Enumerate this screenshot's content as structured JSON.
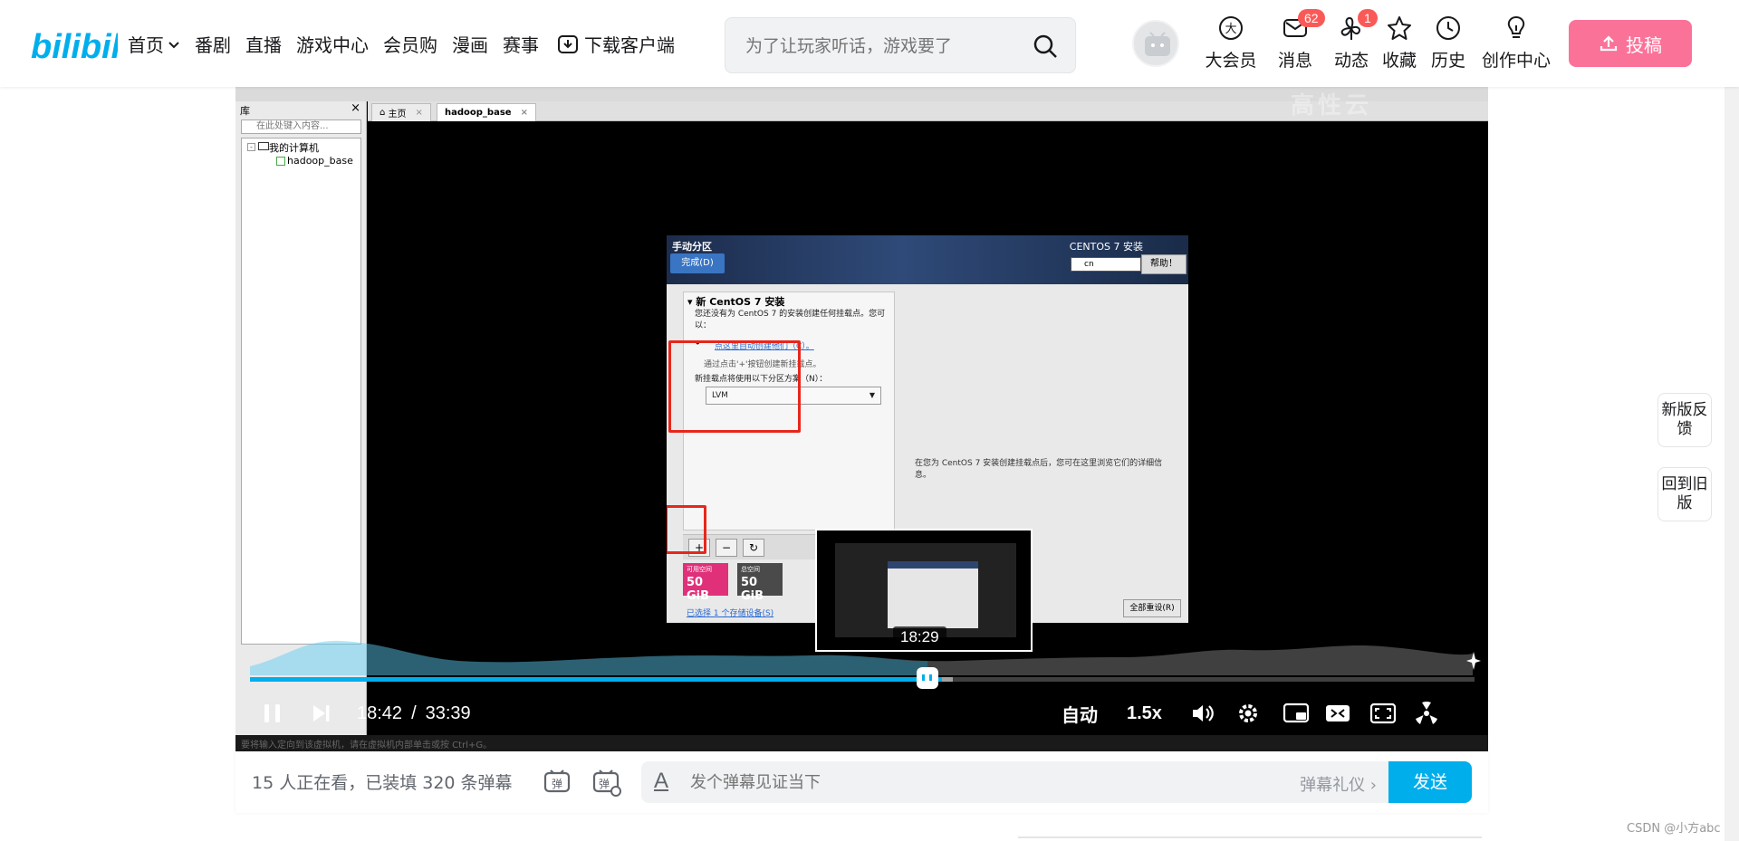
{
  "header": {
    "nav": [
      "首页",
      "番剧",
      "直播",
      "游戏中心",
      "会员购",
      "漫画",
      "赛事",
      "下载客户端"
    ],
    "search_placeholder": "为了让玩家听话，游戏要了",
    "entries": {
      "vip": "大会员",
      "message": "消息",
      "message_badge": "62",
      "dynamic": "动态",
      "dynamic_badge": "1",
      "favorites": "收藏",
      "history": "历史",
      "creator": "创作中心"
    },
    "upload": "投稿"
  },
  "vm": {
    "library_title": "库",
    "library_search": "在此处键入内容...",
    "tree_root": "我的计算机",
    "tree_vm": "hadoop_base",
    "tab_home": "主页",
    "tab_vm": "hadoop_base",
    "status_text": "要将输入定向到该虚拟机，请在虚拟机内部单击或按 Ctrl+G。"
  },
  "installer": {
    "title": "手动分区",
    "done": "完成(D)",
    "product": "CENTOS 7 安装",
    "keyboard": "cn",
    "help": "帮助！",
    "section_heading": "新 CentOS 7 安装",
    "desc": "您还没有为 CentOS 7 的安装创建任何挂载点。您可以：",
    "auto_link": "点这里自动创建他们（C）。",
    "faint_line": "通过点击'+'按钮创建新挂载点。",
    "scheme_label": "新挂载点将使用以下分区方案（N）：",
    "scheme_value": "LVM",
    "right_text": "在您为 CentOS 7 安装创建挂载点后，您可在这里浏览它们的详细信息。",
    "available_label": "可用空间",
    "available_value": "50 GiB",
    "total_label": "总空间",
    "total_value": "50 GiB",
    "selected_link": "已选择 1 个存储设备(S)",
    "reset": "全部重设(R)"
  },
  "player": {
    "watermark": "高性云",
    "hover_time": "18:29",
    "current_time": "18:42",
    "separator": "/",
    "duration": "33:39",
    "quality": "自动",
    "speed": "1.5x",
    "progress_played": 0.565,
    "progress_buffered": 0.574
  },
  "danmaku": {
    "count_text": "15 人正在看，已装填 320 条弹幕",
    "placeholder": "发个弹幕见证当下",
    "etiquette": "弹幕礼仪",
    "send": "发送"
  },
  "float": {
    "feedback": "新版反馈",
    "old_version": "回到旧版"
  },
  "credit": "CSDN @小方abc",
  "colors": {
    "accent_blue": "#00aeec",
    "upload_pink": "#fb7299",
    "badge_red": "#fa5a57",
    "highlight_red": "#e8261b"
  }
}
